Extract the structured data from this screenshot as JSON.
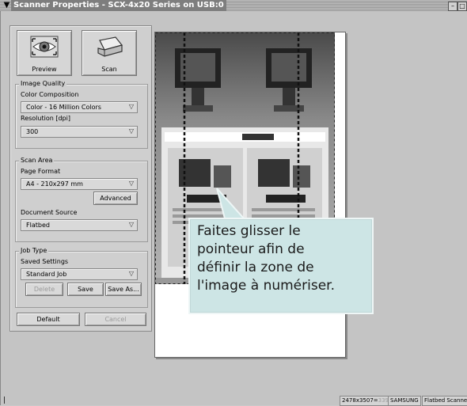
{
  "window": {
    "title": "Scanner Properties - SCX-4x20 Series on USB:0",
    "menu_glyph": "▼",
    "minimize_glyph": "–",
    "maximize_glyph": "□"
  },
  "toolbar": {
    "preview_label": "Preview",
    "scan_label": "Scan"
  },
  "image_quality": {
    "group_title": "Image Quality",
    "color_label": "Color Composition",
    "color_value": "Color - 16 Million Colors",
    "resolution_label": "Resolution [dpi]",
    "resolution_value": "300"
  },
  "scan_area": {
    "group_title": "Scan Area",
    "page_format_label": "Page Format",
    "page_format_value": "A4 - 210x297 mm",
    "advanced_label": "Advanced",
    "document_source_label": "Document Source",
    "document_source_value": "Flatbed"
  },
  "job_type": {
    "group_title": "Job Type",
    "saved_settings_label": "Saved Settings",
    "saved_settings_value": "Standard Job",
    "delete_label": "Delete",
    "save_label": "Save",
    "save_as_label": "Save As..."
  },
  "footer": {
    "default_label": "Default",
    "cancel_label": "Cancel"
  },
  "callout": {
    "lines": [
      "Faites glisser le",
      "pointeur afin de",
      "définir la zone de",
      "l'image à numériser."
    ]
  },
  "statusbar": {
    "dimensions": "2478x3507=",
    "size": "33947K",
    "vendor": "SAMSUNG",
    "device": "Flatbed Scanner"
  },
  "dropdown_glyph": "▽"
}
